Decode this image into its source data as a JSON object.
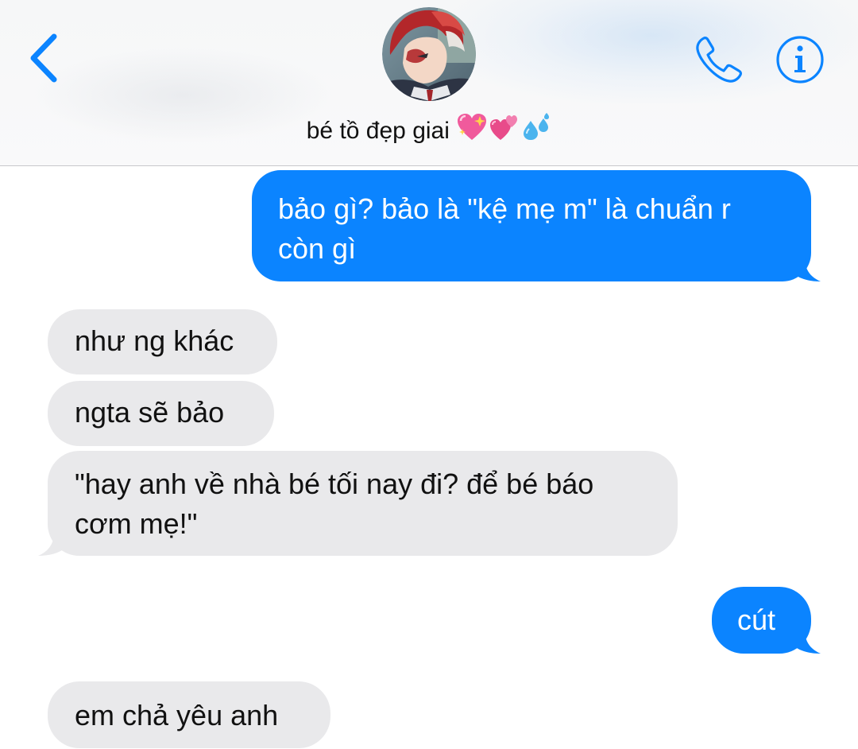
{
  "header": {
    "contact_name": "bé tồ đẹp giai",
    "contact_emoji": [
      "sparkling-heart-emoji",
      "revolving-hearts-emoji",
      "sweat-droplets-emoji"
    ],
    "back_icon": "chevron-left-icon",
    "call_icon": "phone-icon",
    "info_icon": "info-icon"
  },
  "colors": {
    "accent": "#0b84ff",
    "sent_bubble": "#0b84ff",
    "received_bubble": "#e9e9eb",
    "text_dark": "#111111"
  },
  "messages": [
    {
      "direction": "sent",
      "lines": [
        "bảo gì? bảo là \"kệ mẹ m\" là chuẩn r",
        "còn gì"
      ]
    },
    {
      "direction": "received",
      "lines": [
        "như ng khác"
      ]
    },
    {
      "direction": "received",
      "lines": [
        "ngta sẽ bảo"
      ]
    },
    {
      "direction": "received",
      "lines": [
        "\"hay anh về nhà bé tối nay đi? để bé báo",
        "cơm mẹ!\""
      ]
    },
    {
      "direction": "sent",
      "lines": [
        "cút"
      ]
    },
    {
      "direction": "received",
      "lines": [
        "em chả yêu anh"
      ]
    }
  ]
}
